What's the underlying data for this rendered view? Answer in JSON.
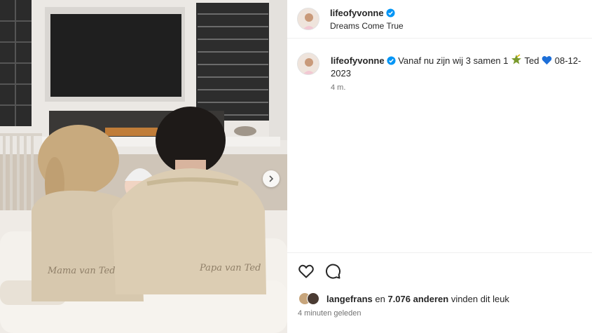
{
  "account": {
    "username": "lifeofyvonne",
    "verified": true,
    "subtitle": "Dreams Come True"
  },
  "caption": {
    "username": "lifeofyvonne",
    "text_part1": "Vanaf nu zijn wij 3 samen 1",
    "emoji1": "star-icon",
    "text_part2": "Ted",
    "emoji2": "blue-heart",
    "text_part3": "08-12-2023",
    "time_ago": "4 m."
  },
  "actions": {
    "like": "heart-icon",
    "comment": "comment-icon"
  },
  "likes": {
    "user": "langefrans",
    "connector": "en",
    "count": "7.076 anderen",
    "suffix": "vinden dit leuk"
  },
  "post_time": "4 minuten geleden",
  "photo": {
    "embroidery_left": "Mama van Ted",
    "embroidery_right": "Papa van Ted"
  },
  "colors": {
    "verified": "#0095f6",
    "heart_emoji": "#1d6fd8",
    "robe": "#d7c8ae"
  }
}
